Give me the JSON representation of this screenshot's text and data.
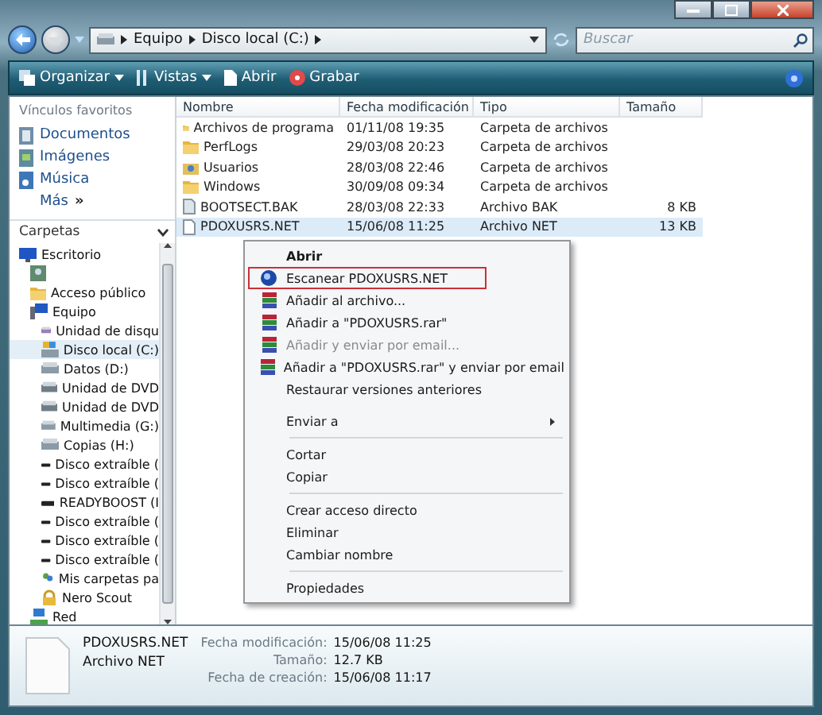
{
  "address": {
    "crumbs": [
      "Equipo",
      "Disco local (C:)"
    ]
  },
  "search": {
    "placeholder": "Buscar"
  },
  "toolbar": [
    {
      "label": "Organizar",
      "kind": "organize",
      "dropdown": true
    },
    {
      "label": "Vistas",
      "kind": "views",
      "dropdown": true
    },
    {
      "label": "Abrir",
      "kind": "open",
      "dropdown": false
    },
    {
      "label": "Grabar",
      "kind": "burn",
      "dropdown": false
    }
  ],
  "favorites": {
    "title": "Vínculos favoritos",
    "items": [
      {
        "label": "Documentos",
        "kind": "documents"
      },
      {
        "label": "Imágenes",
        "kind": "pictures"
      },
      {
        "label": "Música",
        "kind": "music"
      },
      {
        "label": "Más",
        "kind": "more",
        "glyph": "»"
      }
    ]
  },
  "folders": {
    "title": "Carpetas",
    "tree": [
      {
        "label": "Escritorio",
        "kind": "desktop",
        "selected": false,
        "children": [
          {
            "kind": "user",
            "selected": false
          },
          {
            "label": "Acceso público",
            "kind": "folder",
            "selected": false
          },
          {
            "label": "Equipo",
            "kind": "computer",
            "selected": false,
            "children": [
              {
                "label": "Unidad de disqu",
                "kind": "floppy",
                "selected": false
              },
              {
                "label": "Disco local (C:)",
                "kind": "system",
                "selected": true
              },
              {
                "label": "Datos (D:)",
                "kind": "drive",
                "selected": false
              },
              {
                "label": "Unidad de DVD",
                "kind": "dvd",
                "selected": false
              },
              {
                "label": "Unidad de DVD",
                "kind": "dvd",
                "selected": false
              },
              {
                "label": "Multimedia (G:)",
                "kind": "drive",
                "selected": false
              },
              {
                "label": "Copias (H:)",
                "kind": "drive",
                "selected": false
              },
              {
                "label": "Disco extraíble (",
                "kind": "removable",
                "selected": false
              },
              {
                "label": "Disco extraíble (",
                "kind": "removable",
                "selected": false
              },
              {
                "label": "READYBOOST (I",
                "kind": "removable",
                "selected": false
              },
              {
                "label": "Disco extraíble (",
                "kind": "removable",
                "selected": false
              },
              {
                "label": "Disco extraíble (",
                "kind": "removable",
                "selected": false
              },
              {
                "label": "Disco extraíble (",
                "kind": "removable",
                "selected": false
              },
              {
                "label": "Mis carpetas pa",
                "kind": "shared",
                "selected": false
              },
              {
                "label": "Nero Scout",
                "kind": "nero",
                "selected": false
              }
            ]
          },
          {
            "label": "Red",
            "kind": "network",
            "selected": false
          }
        ]
      }
    ]
  },
  "table": {
    "columns": [
      "Nombre",
      "Fecha modificación",
      "Tipo",
      "Tamaño"
    ],
    "rows": [
      {
        "kind": "folder",
        "selected": false,
        "cells": [
          "Archivos de programa",
          "01/11/08 19:35",
          "Carpeta de archivos",
          null
        ]
      },
      {
        "kind": "folder",
        "selected": false,
        "cells": [
          "PerfLogs",
          "29/03/08 20:23",
          "Carpeta de archivos",
          null
        ]
      },
      {
        "kind": "users",
        "selected": false,
        "cells": [
          "Usuarios",
          "28/03/08 22:46",
          "Carpeta de archivos",
          null
        ]
      },
      {
        "kind": "folder",
        "selected": false,
        "cells": [
          "Windows",
          "30/09/08 09:34",
          "Carpeta de archivos",
          null
        ]
      },
      {
        "kind": "bak",
        "selected": false,
        "cells": [
          "BOOTSECT.BAK",
          "28/03/08 22:33",
          "Archivo BAK",
          "8 KB"
        ]
      },
      {
        "kind": "file",
        "selected": true,
        "cells": [
          "PDOXUSRS.NET",
          "15/06/08 11:25",
          "Archivo NET",
          "13 KB"
        ]
      }
    ]
  },
  "context_menu": [
    {
      "kind": "plain",
      "label": "Abrir",
      "default": true,
      "disabled": false,
      "highlighted": false,
      "submenu": false
    },
    {
      "kind": "scan",
      "label": "Escanear PDOXUSRS.NET",
      "default": false,
      "disabled": false,
      "highlighted": true,
      "submenu": false
    },
    {
      "kind": "archive",
      "label": "Añadir al archivo...",
      "default": false,
      "disabled": false,
      "highlighted": false,
      "submenu": false
    },
    {
      "kind": "archive",
      "label": "Añadir a \"PDOXUSRS.rar\"",
      "default": false,
      "disabled": false,
      "highlighted": false,
      "submenu": false
    },
    {
      "kind": "archive",
      "label": "Añadir y enviar por email...",
      "default": false,
      "disabled": true,
      "highlighted": false,
      "submenu": false
    },
    {
      "kind": "archive",
      "label": "Añadir a \"PDOXUSRS.rar\" y enviar por email",
      "default": false,
      "disabled": false,
      "highlighted": false,
      "submenu": false
    },
    {
      "kind": "plain",
      "label": "Restaurar versiones anteriores",
      "default": false,
      "disabled": false,
      "highlighted": false,
      "submenu": false
    },
    {
      "kind": "gap"
    },
    {
      "kind": "plain",
      "label": "Enviar a",
      "default": false,
      "disabled": false,
      "highlighted": false,
      "submenu": true
    },
    {
      "kind": "separator"
    },
    {
      "kind": "plain",
      "label": "Cortar",
      "default": false,
      "disabled": false,
      "highlighted": false,
      "submenu": false
    },
    {
      "kind": "plain",
      "label": "Copiar",
      "default": false,
      "disabled": false,
      "highlighted": false,
      "submenu": false
    },
    {
      "kind": "separator"
    },
    {
      "kind": "plain",
      "label": "Crear acceso directo",
      "default": false,
      "disabled": false,
      "highlighted": false,
      "submenu": false
    },
    {
      "kind": "plain",
      "label": "Eliminar",
      "default": false,
      "disabled": false,
      "highlighted": false,
      "submenu": false
    },
    {
      "kind": "plain",
      "label": "Cambiar nombre",
      "default": false,
      "disabled": false,
      "highlighted": false,
      "submenu": false
    },
    {
      "kind": "separator"
    },
    {
      "kind": "plain",
      "label": "Propiedades",
      "default": false,
      "disabled": false,
      "highlighted": false,
      "submenu": false
    }
  ],
  "details": {
    "name": "PDOXUSRS.NET",
    "type": "Archivo NET",
    "fields": [
      {
        "label": "Fecha modificación:",
        "value": "15/06/08 11:25"
      },
      {
        "label": "Tamaño:",
        "value": "12.7 KB"
      },
      {
        "label": "Fecha de creación:",
        "value": "15/06/08 11:17"
      }
    ]
  }
}
